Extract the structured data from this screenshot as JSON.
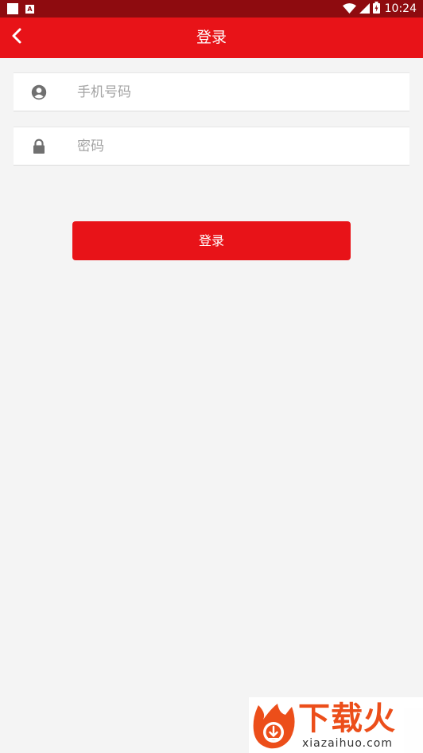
{
  "status_bar": {
    "time": "10:24",
    "a_icon_letter": "A"
  },
  "header": {
    "title": "登录"
  },
  "form": {
    "phone": {
      "value": "",
      "placeholder": "手机号码"
    },
    "password": {
      "value": "",
      "placeholder": "密码"
    }
  },
  "login_button": {
    "label": "登录"
  },
  "watermark": {
    "name": "下载火",
    "url": "xiazaihuo.com"
  },
  "colors": {
    "status_bar": "#8e0b0f",
    "primary": "#e81318",
    "background": "#f4f4f4",
    "placeholder": "#a4a4a4",
    "icon": "#707070",
    "watermark_accent": "#ec4e1a"
  },
  "icons": {
    "back": "chevron-left-icon",
    "phone_field": "user-icon",
    "password_field": "lock-icon",
    "wifi": "wifi-icon",
    "signal": "signal-icon",
    "battery": "battery-icon"
  }
}
